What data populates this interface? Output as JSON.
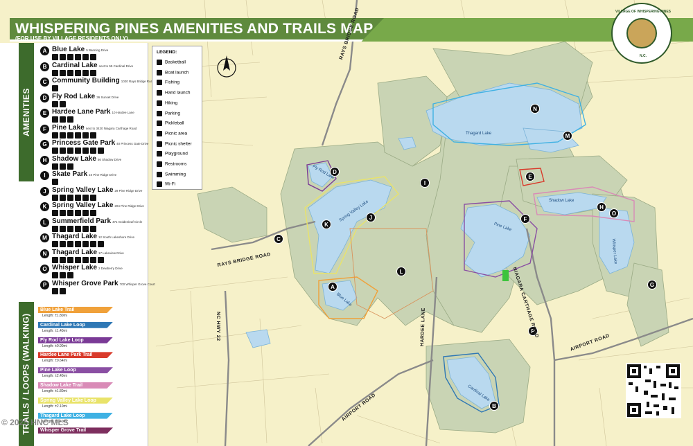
{
  "title": "WHISPERING PINES AMENITIES AND TRAILS MAP",
  "subtitle": "(FOR USE BY VILLAGE RESIDENTS ONLY)",
  "side_tabs": {
    "amenities": "AMENITIES",
    "trails": "TRAILS / LOOPS (WALKING)"
  },
  "amenities": [
    {
      "letter": "A",
      "name": "Blue Lake",
      "addr": "5 Banning Drive",
      "icons": 6
    },
    {
      "letter": "B",
      "name": "Cardinal Lake",
      "addr": "next to 55 Cardinal Drive",
      "icons": 6
    },
    {
      "letter": "C",
      "name": "Community Building",
      "addr": "1020 Rays Bridge Road",
      "icons": 1
    },
    {
      "letter": "D",
      "name": "Fly Rod Lake",
      "addr": "36 Sunset Drive",
      "icons": 2
    },
    {
      "letter": "E",
      "name": "Hardee Lane Park",
      "addr": "10 Hardee Lane",
      "icons": 3
    },
    {
      "letter": "F",
      "name": "Pine Lake",
      "addr": "next to 3420 Niagara Carthage Road",
      "icons": 6
    },
    {
      "letter": "G",
      "name": "Princess Gate Park",
      "addr": "40 Princess Gate Drive",
      "icons": 7
    },
    {
      "letter": "H",
      "name": "Shadow Lake",
      "addr": "56 Shadow Drive",
      "icons": 3
    },
    {
      "letter": "I",
      "name": "Skate Park",
      "addr": "10 Pine Ridge Drive",
      "icons": 1
    },
    {
      "letter": "J",
      "name": "Spring Valley Lake",
      "addr": "29 Pine Ridge Drive",
      "icons": 6
    },
    {
      "letter": "K",
      "name": "Spring Valley Lake",
      "addr": "204 Pine Ridge Drive",
      "icons": 6
    },
    {
      "letter": "L",
      "name": "Summerfield Park",
      "addr": "471 Goldenleaf Circle",
      "icons": 6
    },
    {
      "letter": "M",
      "name": "Thagard Lake",
      "addr": "12 South Lakeshore Drive",
      "icons": 7
    },
    {
      "letter": "N",
      "name": "Thagard Lake",
      "addr": "17 Lakeview Drive",
      "icons": 7
    },
    {
      "letter": "O",
      "name": "Whisper Lake",
      "addr": "2 Dewberry Drive",
      "icons": 3
    },
    {
      "letter": "P",
      "name": "Whisper Grove Park",
      "addr": "700 Whisper Grove Court",
      "icons": 2
    }
  ],
  "trails": [
    {
      "name": "Blue Lake Trail",
      "length": "Length: ±1.80mi",
      "color": "#f0a13a"
    },
    {
      "name": "Cardinal Lake Loop",
      "length": "Length: ±1.40mi",
      "color": "#2f78b5"
    },
    {
      "name": "Fly Rod Lake Loop",
      "length": "Length: ±0.90mi",
      "color": "#7a3a96"
    },
    {
      "name": "Hardee Lane Park Trail",
      "length": "Length: ±0.64mi",
      "color": "#d93a2b"
    },
    {
      "name": "Pine Lake Loop",
      "length": "Length: ±2.40mi",
      "color": "#8a4fa3"
    },
    {
      "name": "Shadow Lake Trail",
      "length": "Length: ±1.80mi",
      "color": "#d98bb7"
    },
    {
      "name": "Spring Valley Lake Loop",
      "length": "Length: ±2.10mi",
      "color": "#e9e36a"
    },
    {
      "name": "Thagard Lake Loop",
      "length": "Length: ±1.40mi",
      "color": "#3fb1e3"
    },
    {
      "name": "Whisper Grove Trail",
      "length": "",
      "color": "#7d2e5e"
    }
  ],
  "legend": {
    "heading": "LEGEND:",
    "items": [
      "Basketball",
      "Boat launch",
      "Fishing",
      "Hand launch",
      "Hiking",
      "Parking",
      "Pickleball",
      "Picnic area",
      "Picnic shelter",
      "Playground",
      "Restrooms",
      "Swimming",
      "Wi-Fi"
    ]
  },
  "roads": {
    "rays_bridge_1": "RAYS BRIDGE ROAD",
    "rays_bridge_2": "RAYS BRIDGE ROAD",
    "niagara": "NIAGARA CARTHAGE ROAD",
    "hardee": "HARDEE LANE",
    "nc22": "NC HWY 22",
    "airport_1": "AIRPORT ROAD",
    "airport_2": "AIRPORT ROAD"
  },
  "lakes": {
    "thagard": "Thagard Lake",
    "shadow": "Shadow Lake",
    "pine": "Pine Lake",
    "spring_valley": "Spring Valley Lake",
    "whisper": "Whisper Lake",
    "fly_rod": "Fly Rod Lake",
    "blue": "Blue Lake",
    "cardinal": "Cardinal Lake"
  },
  "seal": {
    "top": "VILLAGE OF WHISPERING PINES",
    "bottom": "N.C."
  },
  "compass": "N",
  "copyright": "© 2025 HNC MLS",
  "colors": {
    "title_bg": "#5f8a3d",
    "map_bg": "#f6f1c9",
    "developed": "#c9d4b4",
    "water": "#b9d9ef",
    "dark_green": "#3d6b2c"
  }
}
